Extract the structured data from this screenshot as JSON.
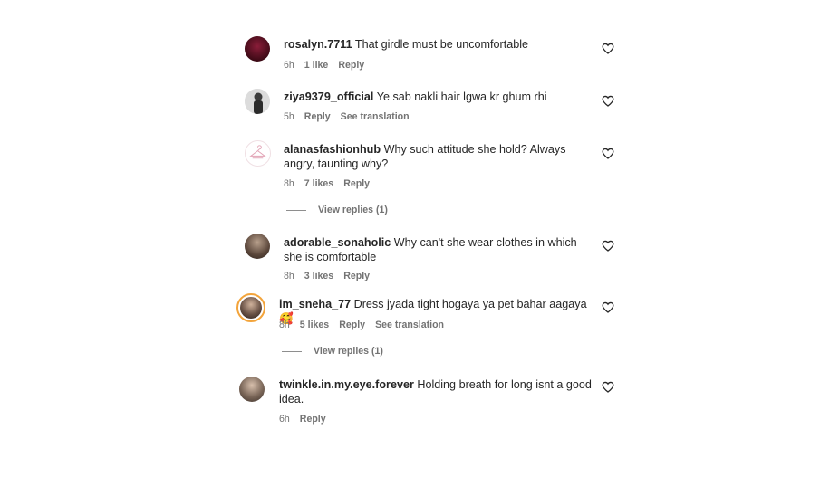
{
  "comments": [
    {
      "username": "rosalyn.7711",
      "text": "That girdle must be uncomfortable",
      "time": "6h",
      "likes": "1 like",
      "reply": "Reply",
      "avatar_color": "#5b0f22"
    },
    {
      "username": "ziya9379_official",
      "text": "Ye sab nakli hair lgwa kr ghum rhi",
      "time": "5h",
      "reply": "Reply",
      "see_translation": "See translation",
      "avatar_color": "#8a8a8a"
    },
    {
      "username": "alanasfashionhub",
      "text": "Why such attitude she hold? Always angry, taunting why?",
      "time": "8h",
      "likes": "7 likes",
      "reply": "Reply",
      "view_replies": "View replies (1)",
      "avatar_color": "#f7e6ea"
    },
    {
      "username": "adorable_sonaholic",
      "text": "Why can't she wear clothes in which she is comfortable",
      "time": "8h",
      "likes": "3 likes",
      "reply": "Reply",
      "avatar_color": "#6e5a4e"
    },
    {
      "username": "im_sneha_77",
      "text": "Dress jyada tight hogaya ya pet bahar aagaya🥰",
      "time": "8h",
      "likes": "5 likes",
      "reply": "Reply",
      "see_translation": "See translation",
      "view_replies": "View replies (1)",
      "avatar_color": "#4a3a34"
    },
    {
      "username": "twinkle.in.my.eye.forever",
      "text": "Holding breath for long isnt a good idea.",
      "time": "6h",
      "reply": "Reply",
      "avatar_color": "#7a6658"
    }
  ],
  "icons": {
    "like": "heart-outline-icon",
    "story_ring_color": "#f3a43b"
  }
}
